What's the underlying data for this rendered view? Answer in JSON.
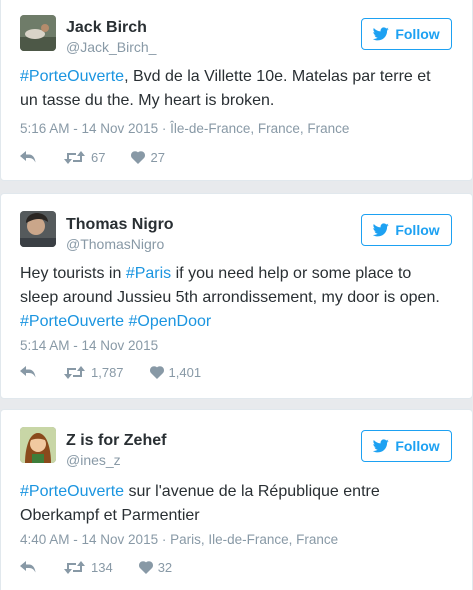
{
  "follow_label": "Follow",
  "tweets": [
    {
      "name": "Jack Birch",
      "handle": "@Jack_Birch_",
      "text": [
        {
          "t": "#PorteOuverte",
          "tag": true
        },
        {
          "t": ", Bvd de la Villette 10e. Matelas par terre et un tasse du the. My heart is broken.",
          "tag": false
        }
      ],
      "meta": "5:16 AM - 14 Nov 2015 · Île-de-France, France, France",
      "retweets": "67",
      "likes": "27"
    },
    {
      "name": "Thomas Nigro",
      "handle": "@ThomasNigro",
      "text": [
        {
          "t": "Hey tourists in ",
          "tag": false
        },
        {
          "t": "#Paris",
          "tag": true
        },
        {
          "t": " if you need help or some place to sleep around Jussieu 5th arrondissement, my door is open. ",
          "tag": false
        },
        {
          "t": "#PorteOuverte",
          "tag": true
        },
        {
          "t": " ",
          "tag": false
        },
        {
          "t": "#OpenDoor",
          "tag": true
        }
      ],
      "meta": "5:14 AM - 14 Nov 2015",
      "retweets": "1,787",
      "likes": "1,401"
    },
    {
      "name": "Z is for Zehef",
      "handle": "@ines_z",
      "text": [
        {
          "t": "#PorteOuverte",
          "tag": true
        },
        {
          "t": " sur l'avenue de la République entre Oberkampf et Parmentier",
          "tag": false
        }
      ],
      "meta": "4:40 AM - 14 Nov 2015 · Paris, Ile-de-France, France",
      "retweets": "134",
      "likes": "32"
    }
  ],
  "colors": {
    "accent": "#1da1f2",
    "hashtag": "#1b95e0",
    "muted": "#8899a6"
  }
}
